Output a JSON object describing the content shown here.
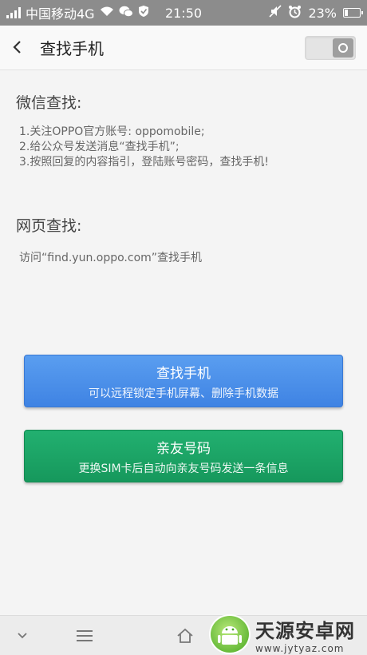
{
  "status_bar": {
    "carrier": "中国移动4G",
    "time": "21:50",
    "battery": "23%",
    "battery_level": 0.23,
    "icons": [
      "signal-icon",
      "wifi-icon",
      "wechat-icon",
      "shield-icon",
      "mute-icon",
      "alarm-icon",
      "battery-icon"
    ]
  },
  "header": {
    "title": "查找手机"
  },
  "wechat_section": {
    "title": "微信查找:",
    "steps": [
      "1.关注OPPO官方账号: oppomobile;",
      "2.给公众号发送消息“查找手机”;",
      "3.按照回复的内容指引，登陆账号密码，查找手机!"
    ]
  },
  "web_section": {
    "title": "网页查找:",
    "desc": "访问“find.yun.oppo.com”查找手机"
  },
  "buttons": {
    "find": {
      "title": "查找手机",
      "sub": "可以远程锁定手机屏幕、删除手机数据",
      "color": "#4a8fe8"
    },
    "family": {
      "title": "亲友号码",
      "sub": "更换SIM卡后自动向亲友号码发送一条信息",
      "color": "#1aa565"
    }
  },
  "watermark": {
    "name": "天源安卓网",
    "url": "www.jytyaz.com"
  }
}
